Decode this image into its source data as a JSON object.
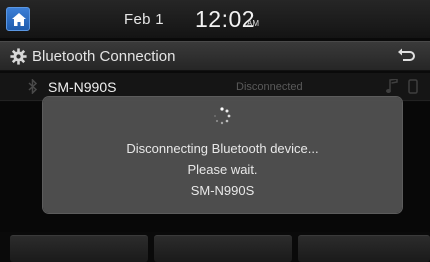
{
  "status": {
    "date": "Feb  1",
    "time": "12:02",
    "ampm": "AM"
  },
  "title_bar": {
    "title": "Bluetooth Connection"
  },
  "device": {
    "name": "SM-N990S",
    "status": "Disconnected"
  },
  "popup": {
    "line1": "Disconnecting Bluetooth device...",
    "line2": "Please wait.",
    "line3": "SM-N990S"
  },
  "icons": {
    "home": "home-icon",
    "settings": "gear-icon",
    "back": "back-arrow-icon",
    "bluetooth": "bluetooth-icon",
    "music": "music-note-icon",
    "phone": "phone-icon",
    "spinner": "loading-spinner-icon"
  },
  "colors": {
    "home_button": "#2b6cc4",
    "popup_bg": "#505050"
  }
}
